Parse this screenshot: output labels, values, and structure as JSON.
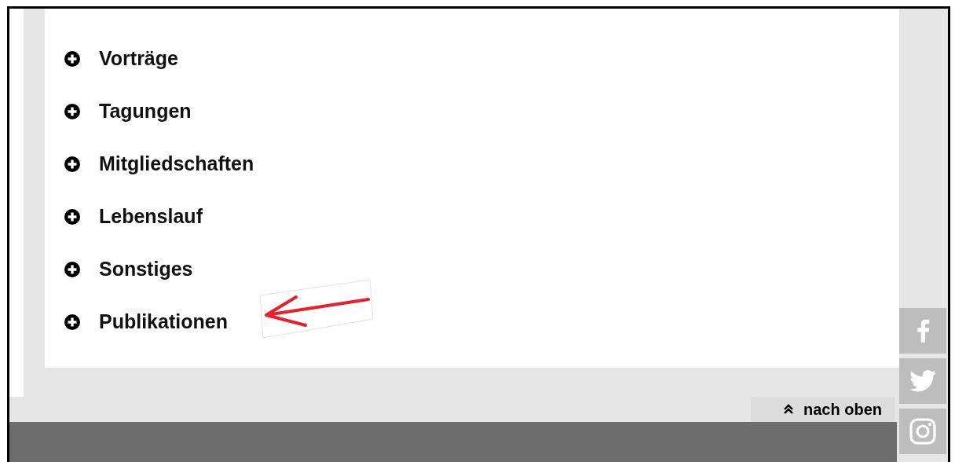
{
  "accordion": [
    {
      "label": "Vorträge",
      "expanded": false,
      "marked": false
    },
    {
      "label": "Tagungen",
      "expanded": false,
      "marked": false
    },
    {
      "label": "Mitgliedschaften",
      "expanded": false,
      "marked": false
    },
    {
      "label": "Lebenslauf",
      "expanded": false,
      "marked": false
    },
    {
      "label": "Sonstiges",
      "expanded": false,
      "marked": false
    },
    {
      "label": "Publikationen",
      "expanded": false,
      "marked": true
    }
  ],
  "back_to_top": {
    "label": "nach oben"
  },
  "social": [
    {
      "kind": "facebook"
    },
    {
      "kind": "twitter"
    },
    {
      "kind": "instagram"
    }
  ]
}
